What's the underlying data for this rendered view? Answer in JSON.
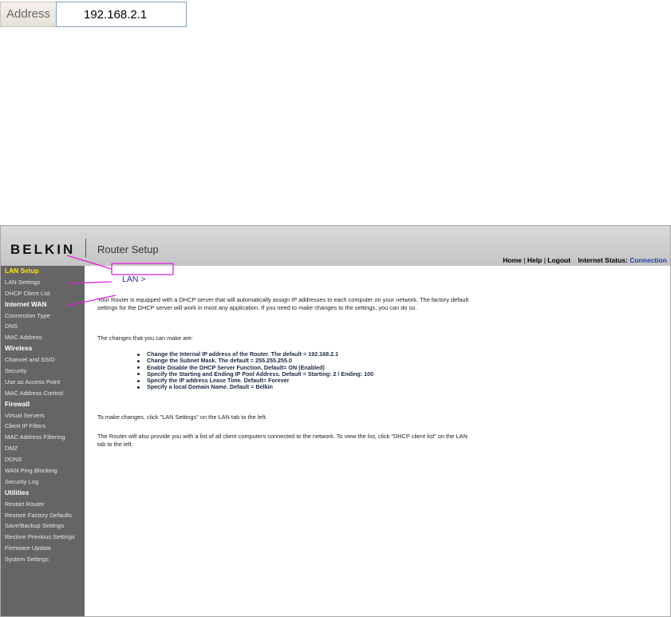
{
  "address_bar": {
    "label": "Address",
    "value": "192.168.2.1"
  },
  "header": {
    "logo": "BELKIN",
    "title": "Router Setup",
    "links": {
      "home": "Home",
      "help": "Help",
      "logout": "Logout",
      "separator": "|"
    },
    "status_label": "Internet Status:",
    "status_value": "Connection"
  },
  "sidebar": {
    "items": [
      {
        "label": "LAN Setup",
        "type": "heading",
        "active": true
      },
      {
        "label": "LAN Settings",
        "type": "link"
      },
      {
        "label": "DHCP Client List",
        "type": "link"
      },
      {
        "label": "Internet WAN",
        "type": "heading"
      },
      {
        "label": "Connection Type",
        "type": "link"
      },
      {
        "label": "DNS",
        "type": "link"
      },
      {
        "label": "MAC Address",
        "type": "link"
      },
      {
        "label": "Wireless",
        "type": "heading"
      },
      {
        "label": "Channel and SSID",
        "type": "link"
      },
      {
        "label": "Security",
        "type": "link"
      },
      {
        "label": "Use as Access Point",
        "type": "link"
      },
      {
        "label": "MAC Address Control",
        "type": "link"
      },
      {
        "label": "Firewall",
        "type": "heading"
      },
      {
        "label": "Virtual Servers",
        "type": "link"
      },
      {
        "label": "Client IP Filters",
        "type": "link"
      },
      {
        "label": "MAC Address Filtering",
        "type": "link"
      },
      {
        "label": "DMZ",
        "type": "link"
      },
      {
        "label": "DDNS",
        "type": "link"
      },
      {
        "label": "WAN Ping Blocking",
        "type": "link"
      },
      {
        "label": "Security Log",
        "type": "link"
      },
      {
        "label": "Utilities",
        "type": "heading"
      },
      {
        "label": "Restart Router",
        "type": "link"
      },
      {
        "label": "Restore Factory Defaults",
        "type": "link"
      },
      {
        "label": "Save/Backup Settings",
        "type": "link"
      },
      {
        "label": "Restore Previous Settings",
        "type": "link"
      },
      {
        "label": "Firmware Update",
        "type": "link"
      },
      {
        "label": "System Settings",
        "type": "link"
      }
    ]
  },
  "content": {
    "breadcrumb": "LAN >",
    "intro": "Your Router is equipped with a DHCP server that will automatically assign IP addresses to each computer on your network. The factory default settings for the DHCP server will work in most any application. If you need to make changes to the settings, you can do so.",
    "changes_heading": "The changes that you can make are:",
    "changes": [
      "Change the Internal IP address of the Router. The default = 192.168.2.1",
      "Change the Subnet Mask. The default = 255.255.255.0",
      "Enable Disable the DHCP Server Function. Default= ON (Enabled)",
      "Specify the Starting and Ending IP Pool Address. Default = Starting: 2 / Ending: 100",
      "Specify the IP address Lease Time. Default= Forever",
      "Specify a local Domain Name. Default = Belkin"
    ],
    "instruction": "To make changes, click \"LAN Settings\" on the LAN tab to the left.",
    "client_list_note": "The Router will also provide you with a list of all client computers connected to the network. To view the list, click \"DHCP client list\" on the LAN tab to the left."
  },
  "colors": {
    "sidebar_bg": "#656565",
    "active_heading": "#ffea00",
    "breadcrumb": "#2a2aa0",
    "status_link": "#1a3fb5",
    "annotation": "#e020e0"
  }
}
